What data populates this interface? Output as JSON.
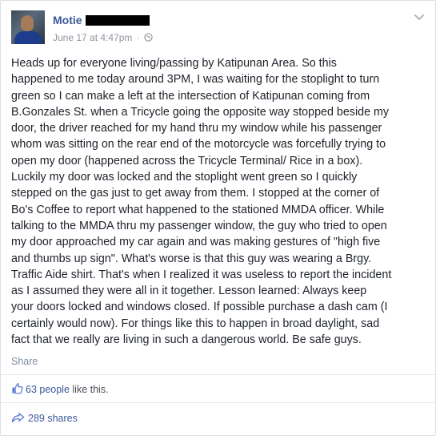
{
  "post": {
    "author_name": "Motie",
    "timestamp": "June 17 at 4:47pm",
    "separator": "·",
    "privacy_icon": "globe-icon",
    "menu_icon": "chevron-down-icon",
    "lines": [
      "Heads up for everyone living/passing by Katipunan Area. So this",
      "happened to me today around 3PM, I was waiting for the stoplight to turn",
      "green so I can make a left at the intersection of Katipunan coming from",
      "B.Gonzales St. when a Tricycle going the opposite way stopped beside my",
      "door, the driver reached for my hand thru my window while his passenger",
      "whom was sitting on the rear end of the motorcycle was forcefully trying to",
      "open my door (happened across the Tricycle Terminal/ Rice in a box).",
      "Luckily my door was locked and the stoplight went green so I quickly",
      "stepped on the gas just to get away from them. I stopped at the corner of",
      "Bo's Coffee to report what happened to the stationed MMDA officer. While",
      "talking to the MMDA thru my passenger window, the guy who tried to open",
      "my door approached my car again and was making gestures of \"high five",
      "and thumbs up sign\". What's worse is that this guy was wearing a Brgy.",
      "Traffic Aide shirt. That's when I realized it was useless to report the incident",
      "as I assumed they were all in it together. Lesson learned: Always keep",
      "your doors locked and windows closed. If possible purchase a dash cam (I",
      "certainly would now). For things like this to happen in broad daylight, sad",
      "fact that we really are living in such a dangerous world. Be safe guys."
    ]
  },
  "actions": {
    "share_label": "Share"
  },
  "stats": {
    "like_icon": "thumbs-up-icon",
    "likes_people": "63 people",
    "likes_suffix": "like this.",
    "share_icon": "share-arrow-icon",
    "shares_label": "289 shares"
  },
  "colors": {
    "link": "#3b5998",
    "meta": "#90949c",
    "text": "#1d2129"
  }
}
